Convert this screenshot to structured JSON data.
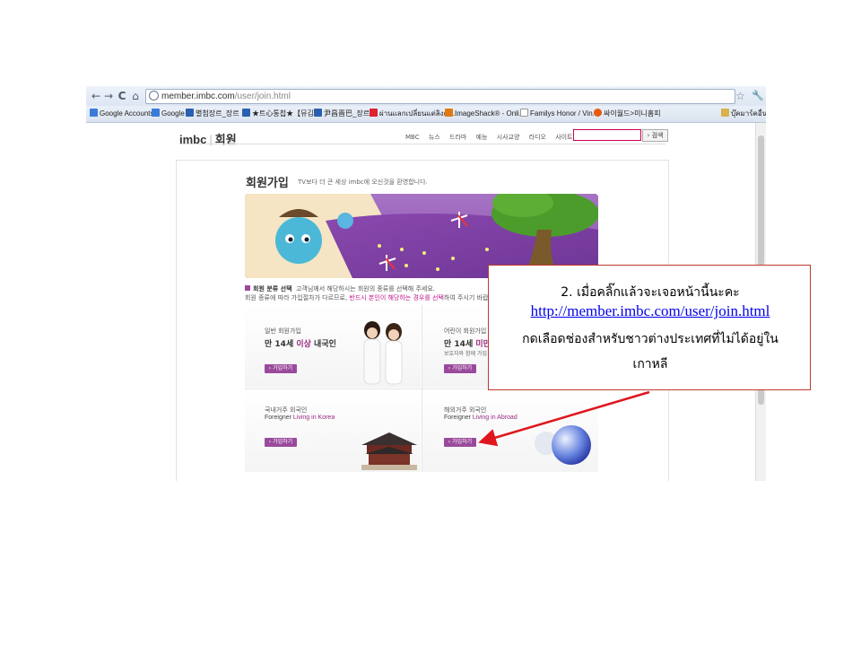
{
  "browser": {
    "back": "←",
    "forward": "→",
    "reload": "C",
    "home": "⌂",
    "url_host": "member.imbc.com",
    "url_path": "/user/join.html",
    "star": "☆",
    "wrench": "🔧",
    "bookmarks": [
      {
        "label": "Google Accounts",
        "icon": "google-icon",
        "color": "#3b7bd8"
      },
      {
        "label": "Google",
        "icon": "google-icon",
        "color": "#3b7bd8"
      },
      {
        "label": "별첨장르_장르",
        "icon": "page-icon",
        "color": "#2a5fb0"
      },
      {
        "label": "★트心통첩★【뮤김...",
        "icon": "page-icon",
        "color": "#2a5fb0"
      },
      {
        "label": "尹昌晋巴_장르",
        "icon": "page-icon",
        "color": "#2a5fb0"
      },
      {
        "label": "ผ่านแลกเปลี่ยนแต่ลิงค์ลิ...",
        "icon": "page-icon",
        "color": "#d23"
      },
      {
        "label": "ImageShack® - Onli...",
        "icon": "page-icon",
        "color": "#e07a10"
      },
      {
        "label": "Familys Honor / Vin...",
        "icon": "page-icon",
        "color": "#999"
      },
      {
        "label": "싸이월드>미니홈피",
        "icon": "page-icon",
        "color": "#e85a0a"
      },
      {
        "label": "บุ๊คมาร์คอื่นๆ",
        "icon": "folder-icon",
        "color": "#d8b24a"
      }
    ]
  },
  "site": {
    "logo": "imbc",
    "logo_sub": "회원",
    "nav": [
      "MBC",
      "뉴스",
      "드라마",
      "예능",
      "시사교양",
      "라디오",
      "사이트맵"
    ],
    "search_button": "› 검색"
  },
  "page": {
    "title": "회원가입",
    "subtitle": "TV보다 더 큰 세상 imbc에 오신것을 환영합니다.",
    "notice_title": "회원 분류 선택",
    "notice_text": "고객님께서 해당하시는 회원의 종류를 선택해 주세요.",
    "notice_line2a": "회원 종류에 따라 가입절차가 다르므로, ",
    "notice_line2b": "반드시 본인이 해당하는 경우를 선택",
    "notice_line2c": "하여 주시기 바랍",
    "cards": [
      {
        "small": "일반 회원가입",
        "big_a": "만 14세 ",
        "big_b": "이상",
        "big_c": " 내국인",
        "button": "› 가입하기"
      },
      {
        "small": "어린이 회원가입",
        "big_a": "만 14세 ",
        "big_b": "미만",
        "big_c": "",
        "note": "보호자와 함께 가입",
        "button": "› 가입하기"
      },
      {
        "small": "국내거주 외국인",
        "en_a": "Foreigner ",
        "en_b": "Living in Korea",
        "button": "› 가입하기"
      },
      {
        "small": "해외거주 외국인",
        "en_a": "Foreigner ",
        "en_b": "Living in Abroad",
        "button": "› 가입하기"
      }
    ]
  },
  "callout": {
    "line1": "2. เมื่อคลิ๊กแล้วจะเจอหน้านี้นะคะ",
    "link": "http://member.imbc.com/user/join.html",
    "line3": "กดเลือดช่องสำหรับชาวต่างประเทศที่ไม่ได้อยู่ใน",
    "line4": "เกาหลี",
    "border_color": "#c0392b",
    "arrow_color": "#e0161e"
  }
}
